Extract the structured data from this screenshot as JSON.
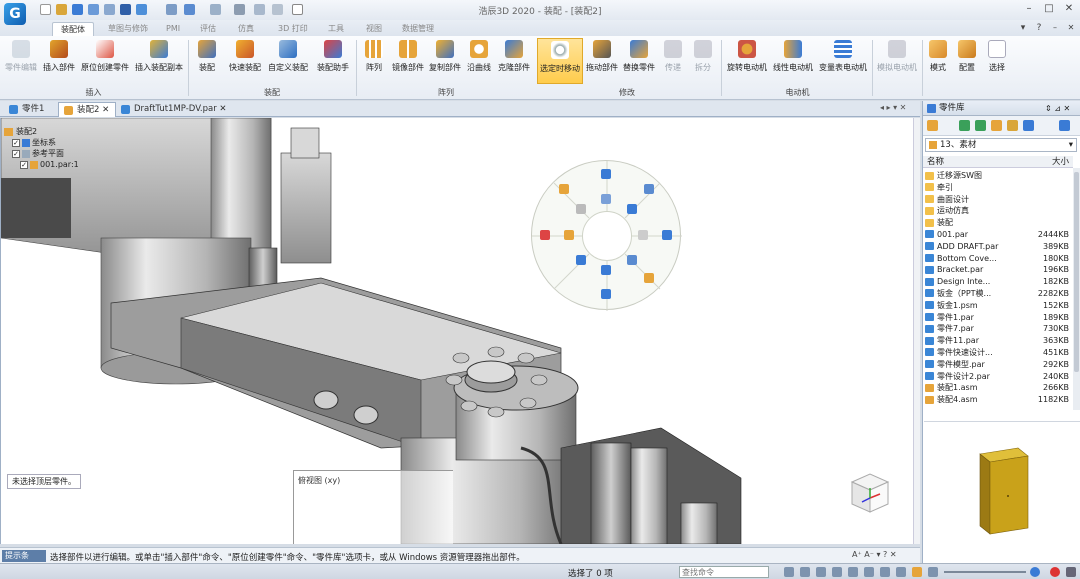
{
  "window": {
    "title": "浩辰3D 2020 - 装配 - [装配2]"
  },
  "ribbon_tabs": [
    "装配体",
    "草图与修饰",
    "PMI",
    "评估",
    "仿真",
    "3D 打印",
    "工具",
    "视图",
    "数据管理"
  ],
  "ribbon": {
    "buttons": [
      "零件编辑",
      "插入部件",
      "原位创建零件",
      "插入装配副本",
      "装配",
      "快速装配",
      "自定义装配",
      "装配助手",
      "阵列",
      "镜像部件",
      "复制部件",
      "沿曲线",
      "克隆部件",
      "选定时移动",
      "拖动部件",
      "替换零件",
      "传递",
      "拆分",
      "旋转电动机",
      "线性电动机",
      "变量表电动机",
      "模拟电动机",
      "模式",
      "配置",
      "选择"
    ],
    "groups": [
      "插入",
      "装配",
      "阵列",
      "修改",
      "电动机"
    ]
  },
  "doc_tabs": [
    "零件1",
    "装配2",
    "DraftTut1MP-DV.par"
  ],
  "tree": {
    "root": "装配2",
    "items": [
      "坐标系",
      "参考平面",
      "001.par:1"
    ]
  },
  "viewport": {
    "hint": "未选择顶层零件。",
    "sketch_label": "俯视图 (xy)"
  },
  "command_bar": {
    "label": "提示条",
    "text": "选择部件以进行编辑。或单击\"插入部件\"命令、\"原位创建零件\"命令、\"零件库\"选项卡，或从 Windows 资源管理器拖出部件。"
  },
  "status": {
    "selection": "选择了 0 项",
    "find_placeholder": "查找命令"
  },
  "library": {
    "title": "零件库",
    "folder": "13、素材",
    "col_name": "名称",
    "col_size": "大小",
    "files": [
      {
        "name": "迁移源SW图",
        "size": "",
        "type": "folder"
      },
      {
        "name": "牵引",
        "size": "",
        "type": "folder"
      },
      {
        "name": "曲面设计",
        "size": "",
        "type": "folder"
      },
      {
        "name": "运动仿真",
        "size": "",
        "type": "folder"
      },
      {
        "name": "装配",
        "size": "",
        "type": "folder"
      },
      {
        "name": "001.par",
        "size": "2444KB",
        "type": "file"
      },
      {
        "name": "ADD DRAFT.par",
        "size": "389KB",
        "type": "file"
      },
      {
        "name": "Bottom Cove...",
        "size": "180KB",
        "type": "file"
      },
      {
        "name": "Bracket.par",
        "size": "196KB",
        "type": "file"
      },
      {
        "name": "Design Inte...",
        "size": "182KB",
        "type": "file"
      },
      {
        "name": "钣金（PPT模...",
        "size": "2282KB",
        "type": "file"
      },
      {
        "name": "钣金1.psm",
        "size": "152KB",
        "type": "file"
      },
      {
        "name": "零件1.par",
        "size": "189KB",
        "type": "file"
      },
      {
        "name": "零件7.par",
        "size": "730KB",
        "type": "file"
      },
      {
        "name": "零件11.par",
        "size": "363KB",
        "type": "file"
      },
      {
        "name": "零件快速设计...",
        "size": "451KB",
        "type": "file"
      },
      {
        "name": "零件模型.par",
        "size": "292KB",
        "type": "file"
      },
      {
        "name": "零件设计2.par",
        "size": "240KB",
        "type": "file"
      },
      {
        "name": "装配1.asm",
        "size": "266KB",
        "type": "file"
      },
      {
        "name": "装配4.asm",
        "size": "1182KB",
        "type": "file"
      }
    ]
  },
  "colors": {
    "accent": "#2b6fc0",
    "selected_button": "#ffcc4c",
    "preview_part": "#c9a21a"
  }
}
